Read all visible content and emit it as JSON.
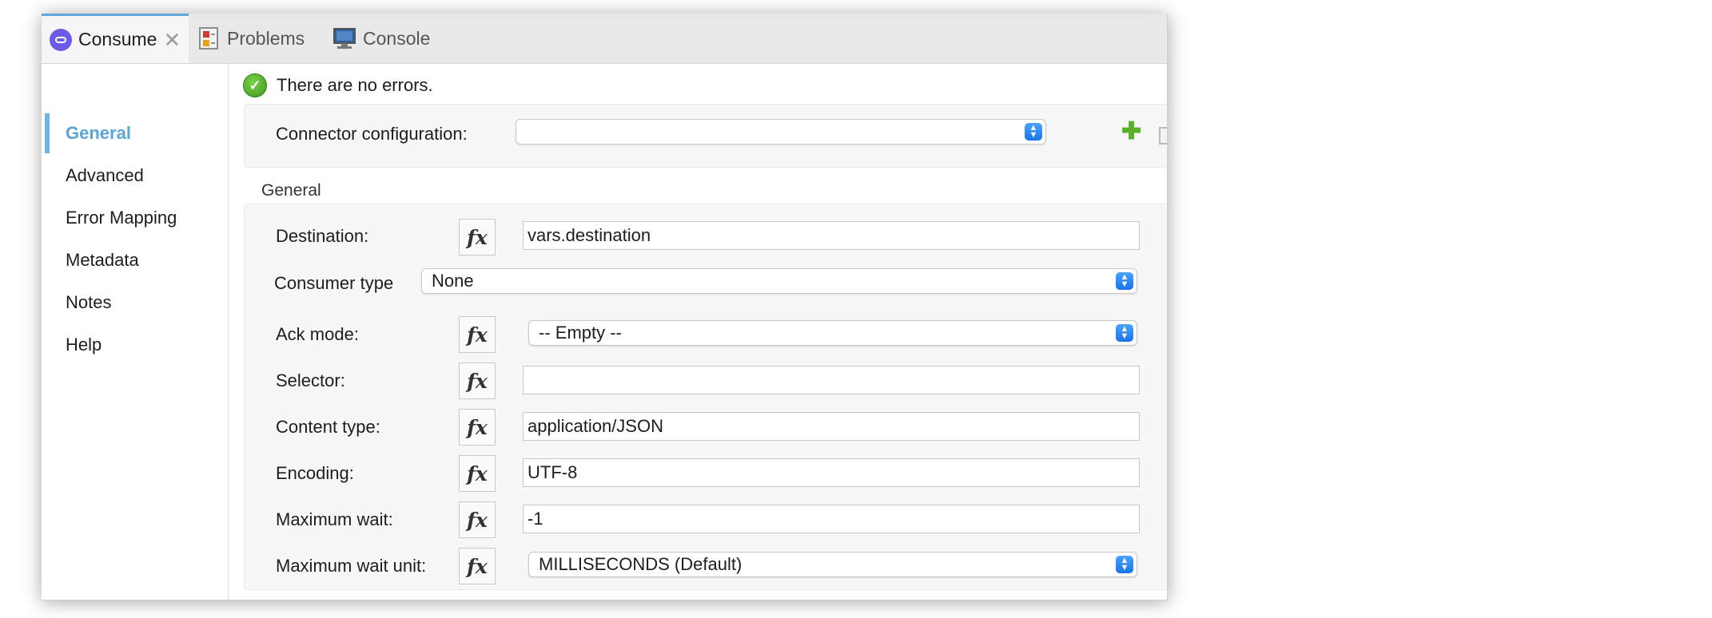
{
  "tabs": {
    "consume": "Consume",
    "problems": "Problems",
    "console": "Console"
  },
  "sidebar": {
    "items": [
      "General",
      "Advanced",
      "Error Mapping",
      "Metadata",
      "Notes",
      "Help"
    ],
    "active": "General"
  },
  "status": {
    "message": "There are no errors."
  },
  "connector": {
    "label": "Connector configuration:",
    "value": ""
  },
  "general": {
    "section_title": "General",
    "destination": {
      "label": "Destination:",
      "value": "vars.destination"
    },
    "consumer_type": {
      "label": "Consumer type",
      "value": "None"
    },
    "ack_mode": {
      "label": "Ack mode:",
      "value": "-- Empty --"
    },
    "selector": {
      "label": "Selector:",
      "value": ""
    },
    "content_type": {
      "label": "Content type:",
      "value": "application/JSON"
    },
    "encoding": {
      "label": "Encoding:",
      "value": "UTF-8"
    },
    "maximum_wait": {
      "label": "Maximum wait:",
      "value": "-1"
    },
    "maximum_wait_unit": {
      "label": "Maximum wait unit:",
      "value": "MILLISECONDS (Default)"
    }
  },
  "fx_label": "fx",
  "icons": {
    "consume": "consume-connector-icon",
    "problems": "problems-icon",
    "console": "console-monitor-icon",
    "status": "green-check-icon",
    "add": "plus-icon",
    "edit": "edit-icon"
  },
  "colors": {
    "accent": "#60a8d8",
    "select_arrow": "#1a73e8",
    "success": "#4caf27"
  }
}
